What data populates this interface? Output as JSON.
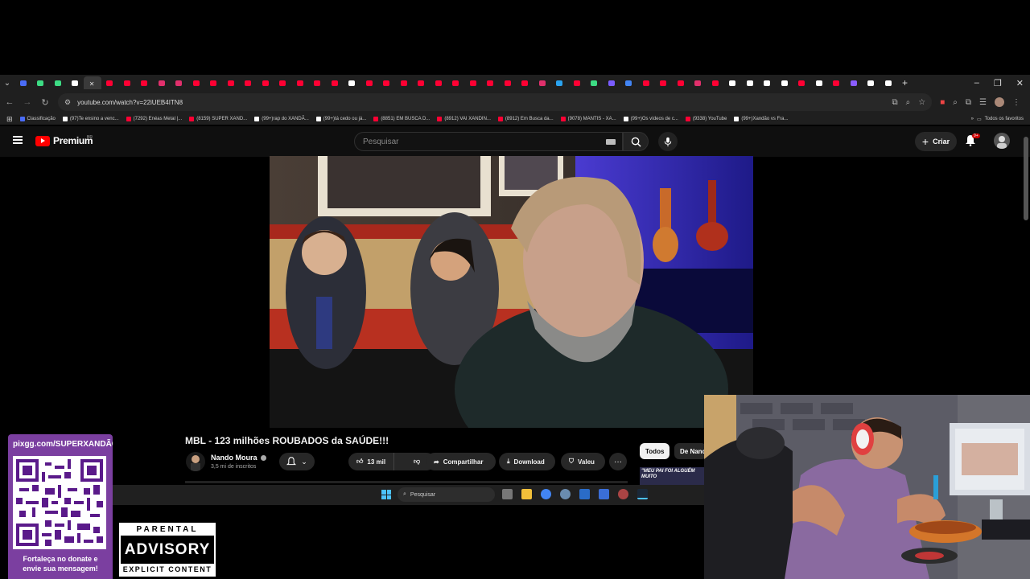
{
  "browser": {
    "tab_favicon_colors": [
      "#4a6cf7",
      "#3ddc84",
      "#3ddc84",
      "#ffffff",
      "#cccccc",
      "#ff0033",
      "#ff0033",
      "#ff0033",
      "#e1306c",
      "#e1306c",
      "#ff0033",
      "#ff0033",
      "#ff0033",
      "#ff0033",
      "#ff0033",
      "#ff0033",
      "#ff0033",
      "#ff0033",
      "#ff0033",
      "#ffffff",
      "#ff0033",
      "#ff0033",
      "#ff0033",
      "#ff0033",
      "#ff0033",
      "#ff0033",
      "#ff0033",
      "#ff0033",
      "#ff0033",
      "#ff0033",
      "#e1306c",
      "#2aa3ef",
      "#ff0033",
      "#3ddc84",
      "#7a5cff",
      "#4285f4",
      "#ff0033",
      "#ff0033",
      "#ff0033",
      "#e1306c",
      "#ff0033",
      "#ffffff",
      "#ffffff",
      "#ffffff",
      "#ffffff",
      "#ff0033",
      "#ffffff",
      "#ff0033",
      "#8a5cff",
      "#ffffff",
      "#ffffff"
    ],
    "url": "youtube.com/watch?v=22iUEB4ITN8",
    "bookmarks": [
      {
        "label": "Classificação",
        "color": "#4a6cf7"
      },
      {
        "label": "(97)Te ensino a venc...",
        "color": "#ffffff"
      },
      {
        "label": "(7292) Enéas Metal |...",
        "color": "#ff0033"
      },
      {
        "label": "(8159) SUPER XAND...",
        "color": "#ff0033"
      },
      {
        "label": "(99+)rap do XANDÃ...",
        "color": "#ffffff"
      },
      {
        "label": "(99+)tá cedo ou já...",
        "color": "#ffffff"
      },
      {
        "label": "(8851) EM BUSCA D...",
        "color": "#ff0033"
      },
      {
        "label": "(8912) VAI XANDIN...",
        "color": "#ff0033"
      },
      {
        "label": "(8912) Em Busca da...",
        "color": "#ff0033"
      },
      {
        "label": "(9078) MANTIS - XA...",
        "color": "#ff0033"
      },
      {
        "label": "(99+)Os vídeos de c...",
        "color": "#ffffff"
      },
      {
        "label": "(9338) YouTube",
        "color": "#ff0033"
      },
      {
        "label": "(99+)Xandão vs Fra...",
        "color": "#ffffff"
      }
    ],
    "all_bookmarks": "Todos os favoritos"
  },
  "youtube": {
    "logo_text": "Premium",
    "country": "BR",
    "search_placeholder": "Pesquisar",
    "create_label": "Criar",
    "notification_count": "9+",
    "video": {
      "title": "MBL - 123 milhões ROUBADOS da SAÚDE!!!",
      "channel": "Nando Moura",
      "subscribers": "3,5 mi de inscritos",
      "likes": "13 mil",
      "share_label": "Compartilhar",
      "download_label": "Download",
      "thanks_label": "Valeu",
      "more": "···"
    },
    "chips": [
      "Todos",
      "De Nando"
    ],
    "thumb_caption": "\"MEU PAI FOI ALGUÉM MUITO"
  },
  "taskbar": {
    "search_label": "Pesquisar"
  },
  "overlay": {
    "donate_url": "pixgg.com/SUPERXANDÃO",
    "donate_msg_1": "Fortaleça no donate e",
    "donate_msg_2": "envie sua mensagem!",
    "advisory_top": "PARENTAL",
    "advisory_mid": "ADVISORY",
    "advisory_bot": "EXPLICIT CONTENT"
  }
}
